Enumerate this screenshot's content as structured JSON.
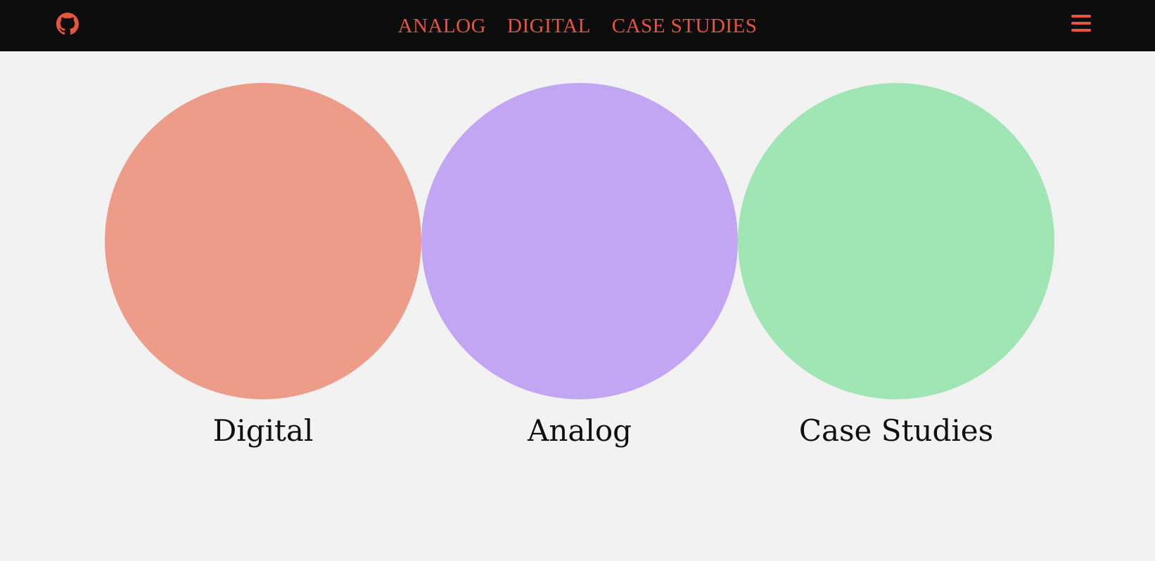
{
  "header": {
    "github_icon": "github-icon",
    "menu_icon": "hamburger-menu-icon",
    "accent_color": "#e8553f",
    "background_color": "#0d0d0d",
    "nav": [
      {
        "label": "ANALOG"
      },
      {
        "label": "DIGITAL"
      },
      {
        "label": "CASE STUDIES"
      }
    ]
  },
  "main": {
    "background_color": "#f2f2f2",
    "cards": [
      {
        "label": "Digital",
        "color": "#ee9c8a"
      },
      {
        "label": "Analog",
        "color": "#c3a6f3"
      },
      {
        "label": "Case Studies",
        "color": "#a0e6b4"
      }
    ]
  }
}
